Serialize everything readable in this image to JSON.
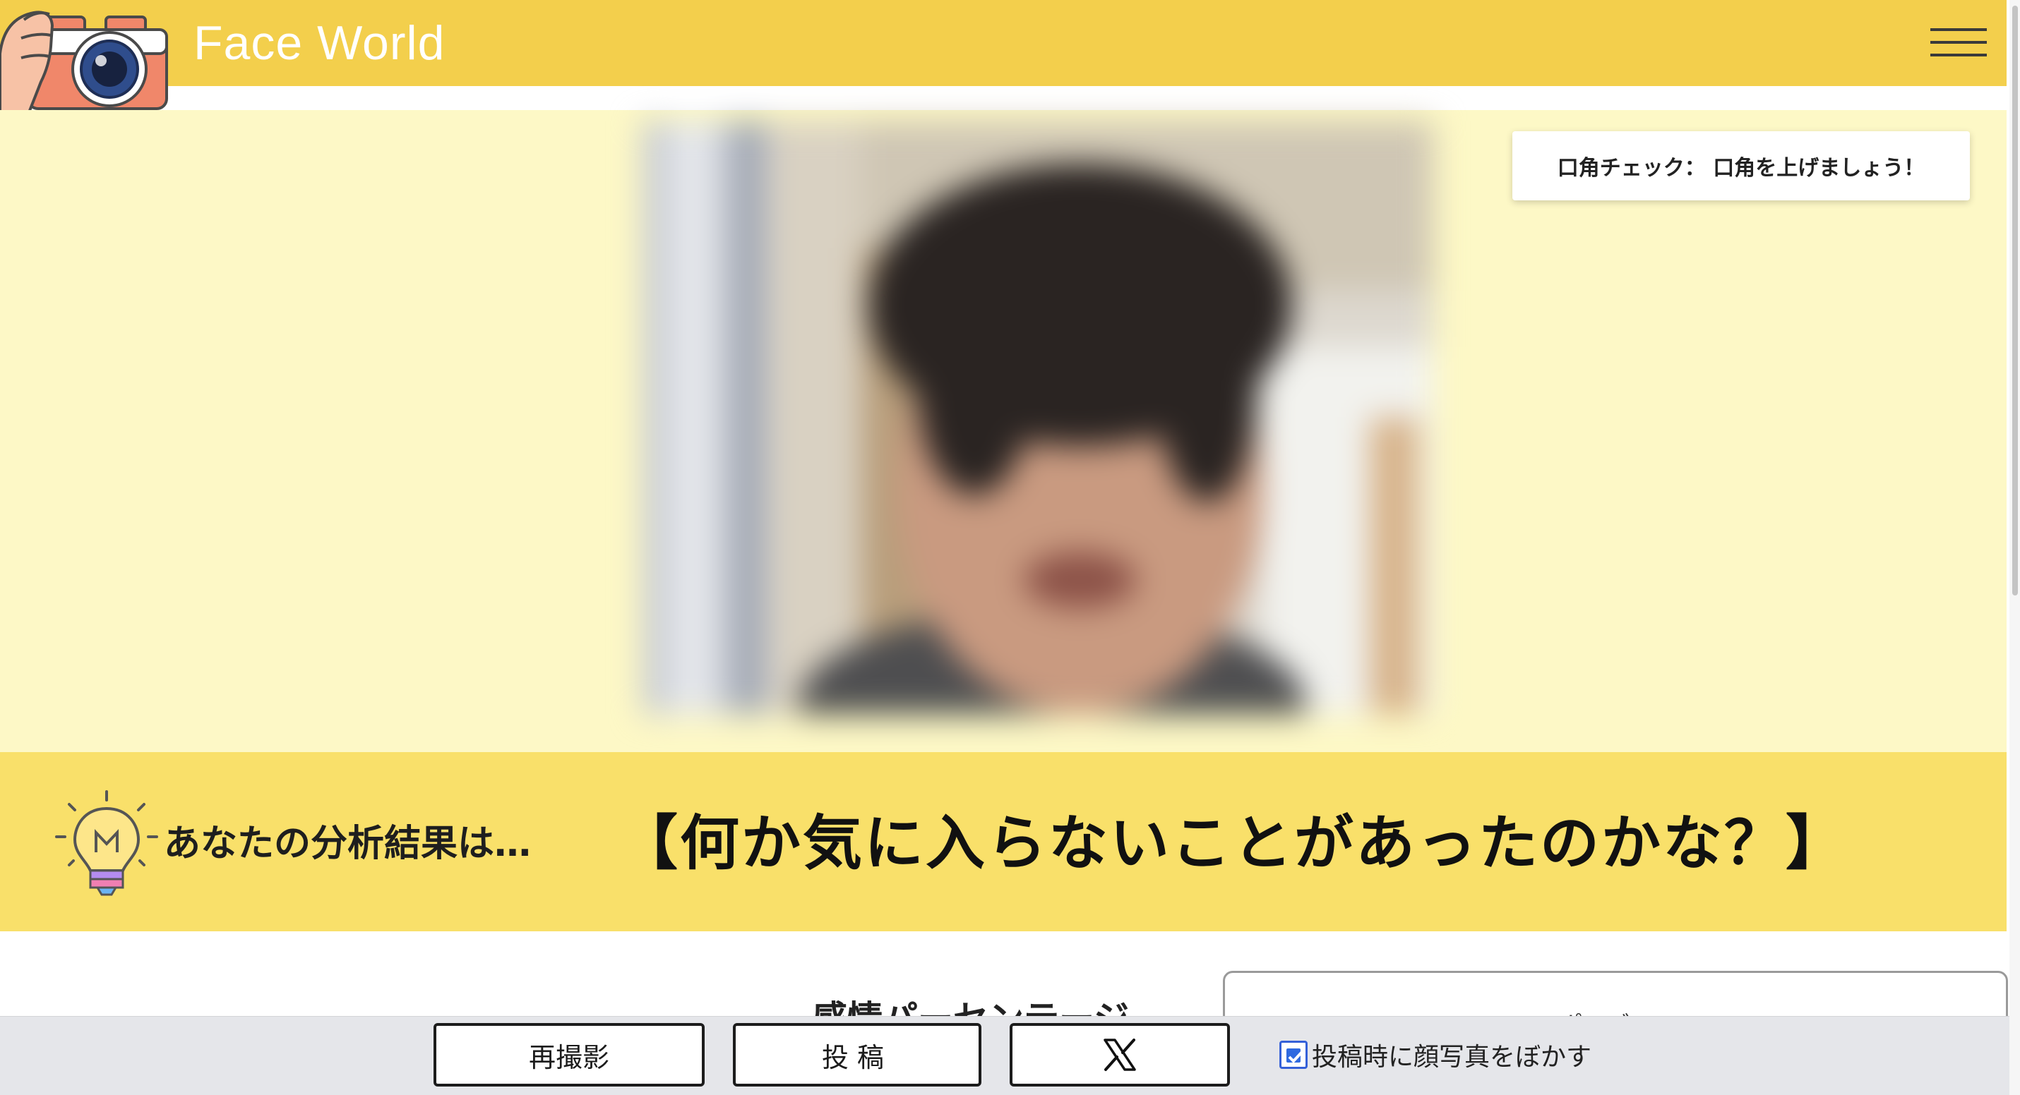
{
  "header": {
    "brand": "Face World",
    "logo_icon": "camera-logo-icon",
    "menu_icon": "hamburger-menu-icon"
  },
  "hero": {
    "mouth_check": "口角チェック： 口角を上げましょう！",
    "photo": "blurred-face-photo"
  },
  "result": {
    "prefix": "あなたの分析結果は…",
    "text": "【何か気に入らないことがあったのかな？】",
    "icon": "lightbulb-icon"
  },
  "lower": {
    "heading": "感情パーセンテージ",
    "card_title": "ポーズ"
  },
  "actions": {
    "retake_label": "再撮影",
    "post_label": "投稿",
    "x_icon": "x-logo-icon",
    "blur_label": "投稿時に顔写真をぼかす",
    "blur_checked": true
  },
  "colors": {
    "header_bg": "#f3cf4c",
    "hero_bg": "#fdf8c6",
    "result_bg": "#f9e06a",
    "checkbox_accent": "#2f6ae0"
  }
}
